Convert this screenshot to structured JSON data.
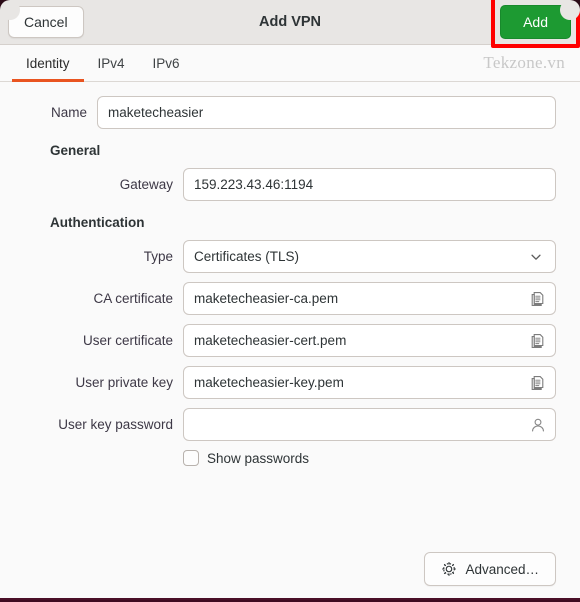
{
  "window": {
    "title": "Add VPN",
    "cancel_label": "Cancel",
    "add_label": "Add"
  },
  "tabs": [
    {
      "label": "Identity",
      "active": true
    },
    {
      "label": "IPv4",
      "active": false
    },
    {
      "label": "IPv6",
      "active": false
    }
  ],
  "watermark": "Tekzone.vn",
  "form": {
    "name": {
      "label": "Name",
      "value": "maketecheasier",
      "placeholder": ""
    },
    "general": {
      "heading": "General",
      "gateway": {
        "label": "Gateway",
        "value": "159.223.43.46:1194",
        "placeholder": ""
      }
    },
    "authentication": {
      "heading": "Authentication",
      "type": {
        "label": "Type",
        "value": "Certificates (TLS)",
        "icon": "chevron-down-icon"
      },
      "ca_certificate": {
        "label": "CA certificate",
        "value": "maketecheasier-ca.pem",
        "placeholder": "",
        "icon": "file-chooser-icon"
      },
      "user_certificate": {
        "label": "User certificate",
        "value": "maketecheasier-cert.pem",
        "placeholder": "",
        "icon": "file-chooser-icon"
      },
      "user_private_key": {
        "label": "User private key",
        "value": "maketecheasier-key.pem",
        "placeholder": "",
        "icon": "file-chooser-icon"
      },
      "user_key_password": {
        "label": "User key password",
        "value": "",
        "placeholder": "",
        "icon": "person-icon"
      },
      "show_passwords": {
        "label": "Show passwords",
        "checked": false
      }
    }
  },
  "footer": {
    "advanced_label": "Advanced…",
    "advanced_icon": "gear-icon"
  },
  "colors": {
    "accent_orange": "#e95420",
    "add_button_green": "#1d9a32",
    "annotation_red": "#ff0000",
    "headerbar_gray": "#e8e6e4",
    "body_gray": "#fafafa"
  }
}
